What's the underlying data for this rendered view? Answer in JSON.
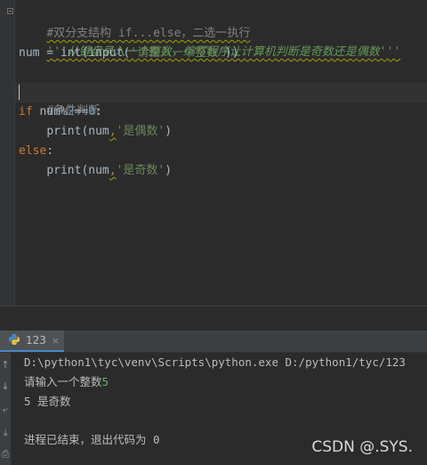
{
  "editor": {
    "line1_comment": "#双分支结构 if...else，二选一执行",
    "line2_docstring": "'''从键盘录入一个整数，编写程序让计算机判断是奇数还是偶数'''",
    "line3": {
      "var": "num",
      "op": " = ",
      "func1": "int",
      "paren_open": "(",
      "func2": "input",
      "paren_open2": "(",
      "string": "'请输入一个整数'",
      "close": "))"
    },
    "line5_comment": "#条件判断",
    "line6": {
      "kw": "if",
      "expr_a": " num%",
      "n1": "2",
      "expr_b": "==",
      "n2": "0",
      "colon": ":"
    },
    "line7": {
      "func": "print",
      "open": "(",
      "var": "num",
      "comma": ",",
      "string": "'是偶数'",
      "close": ")"
    },
    "line8": {
      "kw": "else",
      "colon": ":"
    },
    "line9": {
      "func": "print",
      "open": "(",
      "var": "num",
      "comma": ",",
      "string": "'是奇数'",
      "close": ")"
    }
  },
  "run_tab": {
    "label": "123",
    "close": "×",
    "icon": "python-icon"
  },
  "console": {
    "command": "D:\\python1\\tyc\\venv\\Scripts\\python.exe D:/python1/tyc/123",
    "prompt": "请输入一个整数",
    "input_value": "5",
    "result": "5 是奇数",
    "exit_message": "进程已结束，退出代码为 0"
  },
  "watermark": "CSDN @.SYS.",
  "colors": {
    "background": "#2b2b2b",
    "keyword": "#cc7832",
    "string": "#6a8759",
    "number": "#6897bb",
    "comment": "#808080",
    "docstring": "#629755",
    "input": "#5fb760"
  },
  "tool_icons": [
    "up-arrow-icon",
    "down-arrow-icon",
    "wrap-icon",
    "scroll-to-end-icon",
    "print-icon"
  ]
}
